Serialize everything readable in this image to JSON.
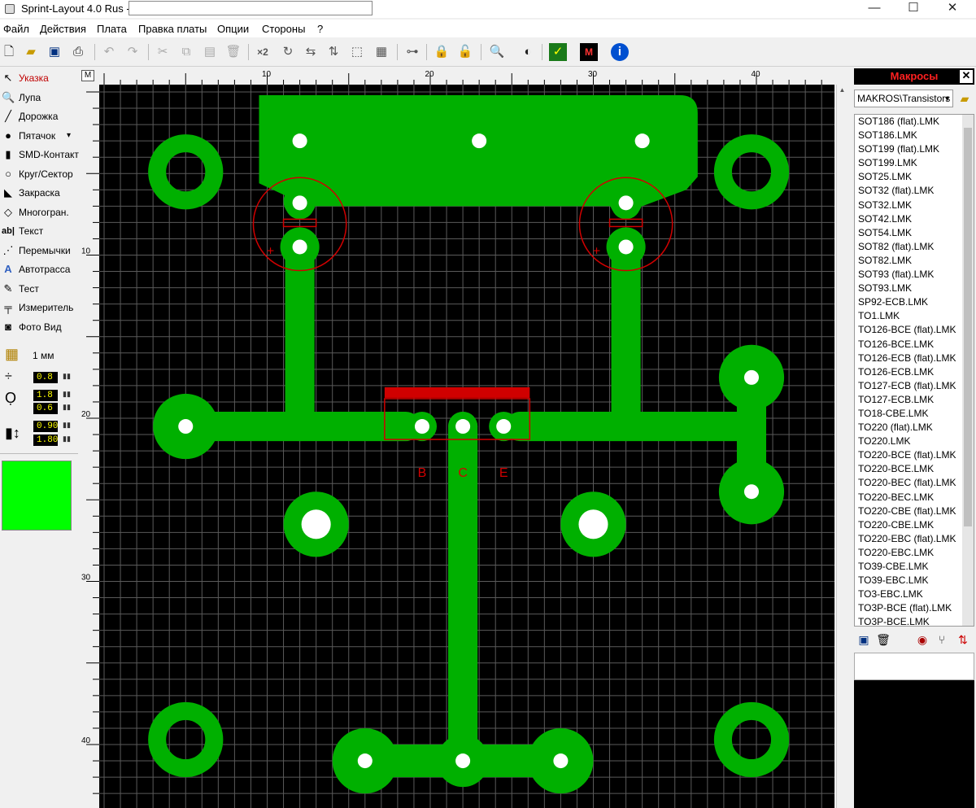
{
  "window": {
    "title": "Sprint-Layout 4.0 Rus -",
    "minimize": "—",
    "maximize": "☐",
    "close": "✕"
  },
  "menu": [
    "Файл",
    "Действия",
    "Плата",
    "Правка платы",
    "Опции",
    "Стороны",
    "?"
  ],
  "toolbar": {
    "x2_label": "×2"
  },
  "tools": [
    {
      "label": "Указка",
      "icon": "pointer-icon",
      "glyph": "↖"
    },
    {
      "label": "Лупа",
      "icon": "magnifier-icon",
      "glyph": "🔍"
    },
    {
      "label": "Дорожка",
      "icon": "track-icon",
      "glyph": "╱"
    },
    {
      "label": "Пятачок",
      "icon": "pad-icon",
      "glyph": "●"
    },
    {
      "label": "SMD-Контакт",
      "icon": "smd-pad-icon",
      "glyph": "▮"
    },
    {
      "label": "Круг/Сектор",
      "icon": "circle-icon",
      "glyph": "○"
    },
    {
      "label": "Закраска",
      "icon": "fill-icon",
      "glyph": "◣"
    },
    {
      "label": "Многогран.",
      "icon": "polygon-icon",
      "glyph": "◇"
    },
    {
      "label": "Текст",
      "icon": "text-icon",
      "glyph": "ab|"
    },
    {
      "label": "Перемычки",
      "icon": "jumper-icon",
      "glyph": "⋰"
    },
    {
      "label": "Автотрасса",
      "icon": "autoroute-icon",
      "glyph": "A"
    },
    {
      "label": "Тест",
      "icon": "test-icon",
      "glyph": "✎"
    },
    {
      "label": "Измеритель",
      "icon": "ruler-icon",
      "glyph": "╤"
    },
    {
      "label": "Фото Вид",
      "icon": "camera-icon",
      "glyph": "◙"
    }
  ],
  "grid_size": "1 мм",
  "params": {
    "track_width": "0.8",
    "pad_outer": "1.8",
    "pad_inner": "0.6",
    "smd_width": "0.90",
    "smd_height": "1.80"
  },
  "ruler": {
    "corner": "M",
    "top_labels": [
      "10",
      "20",
      "30",
      "40"
    ],
    "left_labels": [
      "10",
      "20",
      "30",
      "40"
    ]
  },
  "board": {
    "silk_letters": [
      "B",
      "C",
      "E"
    ],
    "plus_sign": "+"
  },
  "colors": {
    "copper": "#00b000",
    "silk": "#d00000",
    "board_bg": "#000000",
    "grid": "#5a5a5a",
    "active_color": "#00ff00"
  },
  "macros": {
    "title": "Макросы",
    "path": "MAKROS\\Transistors",
    "items": [
      "SOT186 (flat).LMK",
      "SOT186.LMK",
      "SOT199 (flat).LMK",
      "SOT199.LMK",
      "SOT25.LMK",
      "SOT32 (flat).LMK",
      "SOT32.LMK",
      "SOT42.LMK",
      "SOT54.LMK",
      "SOT82 (flat).LMK",
      "SOT82.LMK",
      "SOT93 (flat).LMK",
      "SOT93.LMK",
      "SP92-ECB.LMK",
      "TO1.LMK",
      "TO126-BCE (flat).LMK",
      "TO126-BCE.LMK",
      "TO126-ECB (flat).LMK",
      "TO126-ECB.LMK",
      "TO127-ECB (flat).LMK",
      "TO127-ECB.LMK",
      "TO18-CBE.LMK",
      "TO220 (flat).LMK",
      "TO220.LMK",
      "TO220-BCE (flat).LMK",
      "TO220-BCE.LMK",
      "TO220-BEC (flat).LMK",
      "TO220-BEC.LMK",
      "TO220-CBE (flat).LMK",
      "TO220-CBE.LMK",
      "TO220-EBC (flat).LMK",
      "TO220-EBC.LMK",
      "TO39-CBE.LMK",
      "TO39-EBC.LMK",
      "TO3-EBC.LMK",
      "TO3P-BCE (flat).LMK",
      "TO3P-BCE.LMK"
    ]
  }
}
